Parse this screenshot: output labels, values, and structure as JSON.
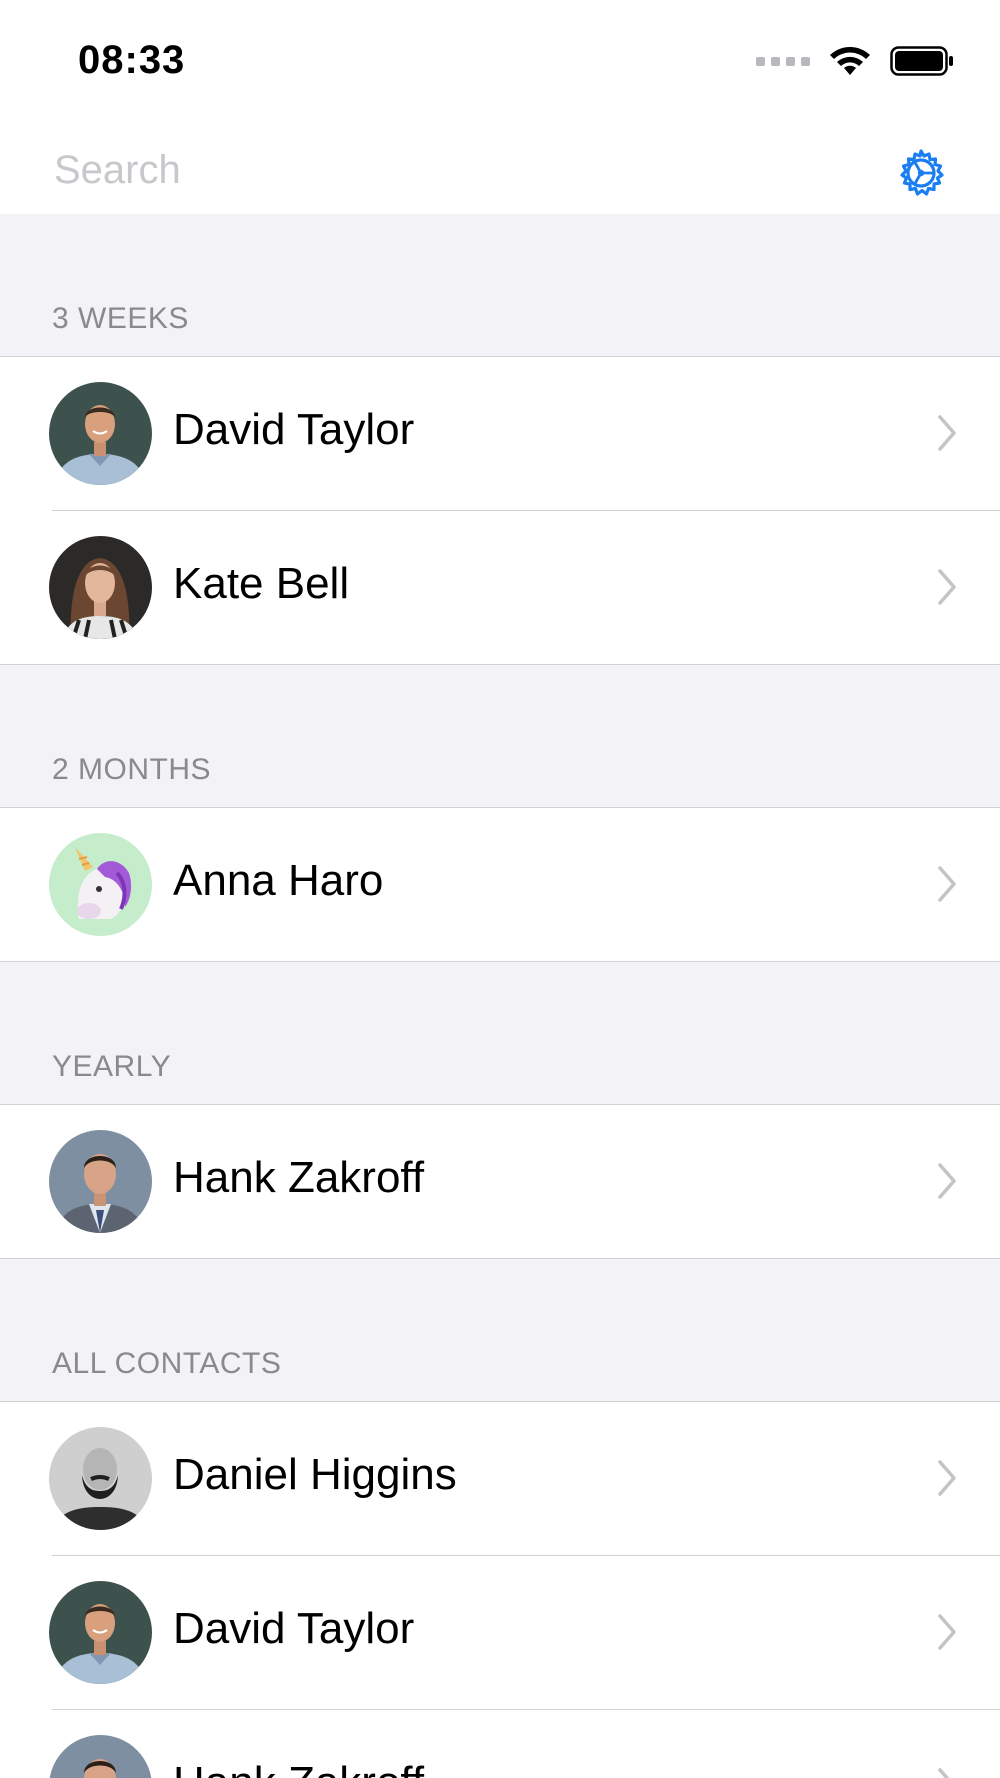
{
  "status_bar": {
    "time": "08:33"
  },
  "search": {
    "placeholder": "Search"
  },
  "icons": {
    "settings": "gear-icon",
    "chevron": "chevron-right-icon",
    "wifi": "wifi-icon",
    "battery": "battery-icon"
  },
  "colors": {
    "accent": "#1a7ef2",
    "section_background": "#f2f2f7",
    "section_text": "#8a8a8e",
    "chevron": "#c4c4c7"
  },
  "sections": [
    {
      "header": "3 WEEKS",
      "contacts": [
        {
          "name": "David Taylor",
          "avatar": "photo-man-smiling"
        },
        {
          "name": "Kate Bell",
          "avatar": "photo-woman"
        }
      ]
    },
    {
      "header": "2 MONTHS",
      "contacts": [
        {
          "name": "Anna Haro",
          "avatar": "unicorn-memoji"
        }
      ]
    },
    {
      "header": "YEARLY",
      "contacts": [
        {
          "name": "Hank Zakroff",
          "avatar": "photo-man-suit"
        }
      ]
    },
    {
      "header": "ALL CONTACTS",
      "contacts": [
        {
          "name": "Daniel Higgins",
          "avatar": "photo-bearded-man"
        },
        {
          "name": "David Taylor",
          "avatar": "photo-man-smiling"
        },
        {
          "name": "Hank Zakroff",
          "avatar": "photo-man-suit"
        }
      ]
    }
  ]
}
